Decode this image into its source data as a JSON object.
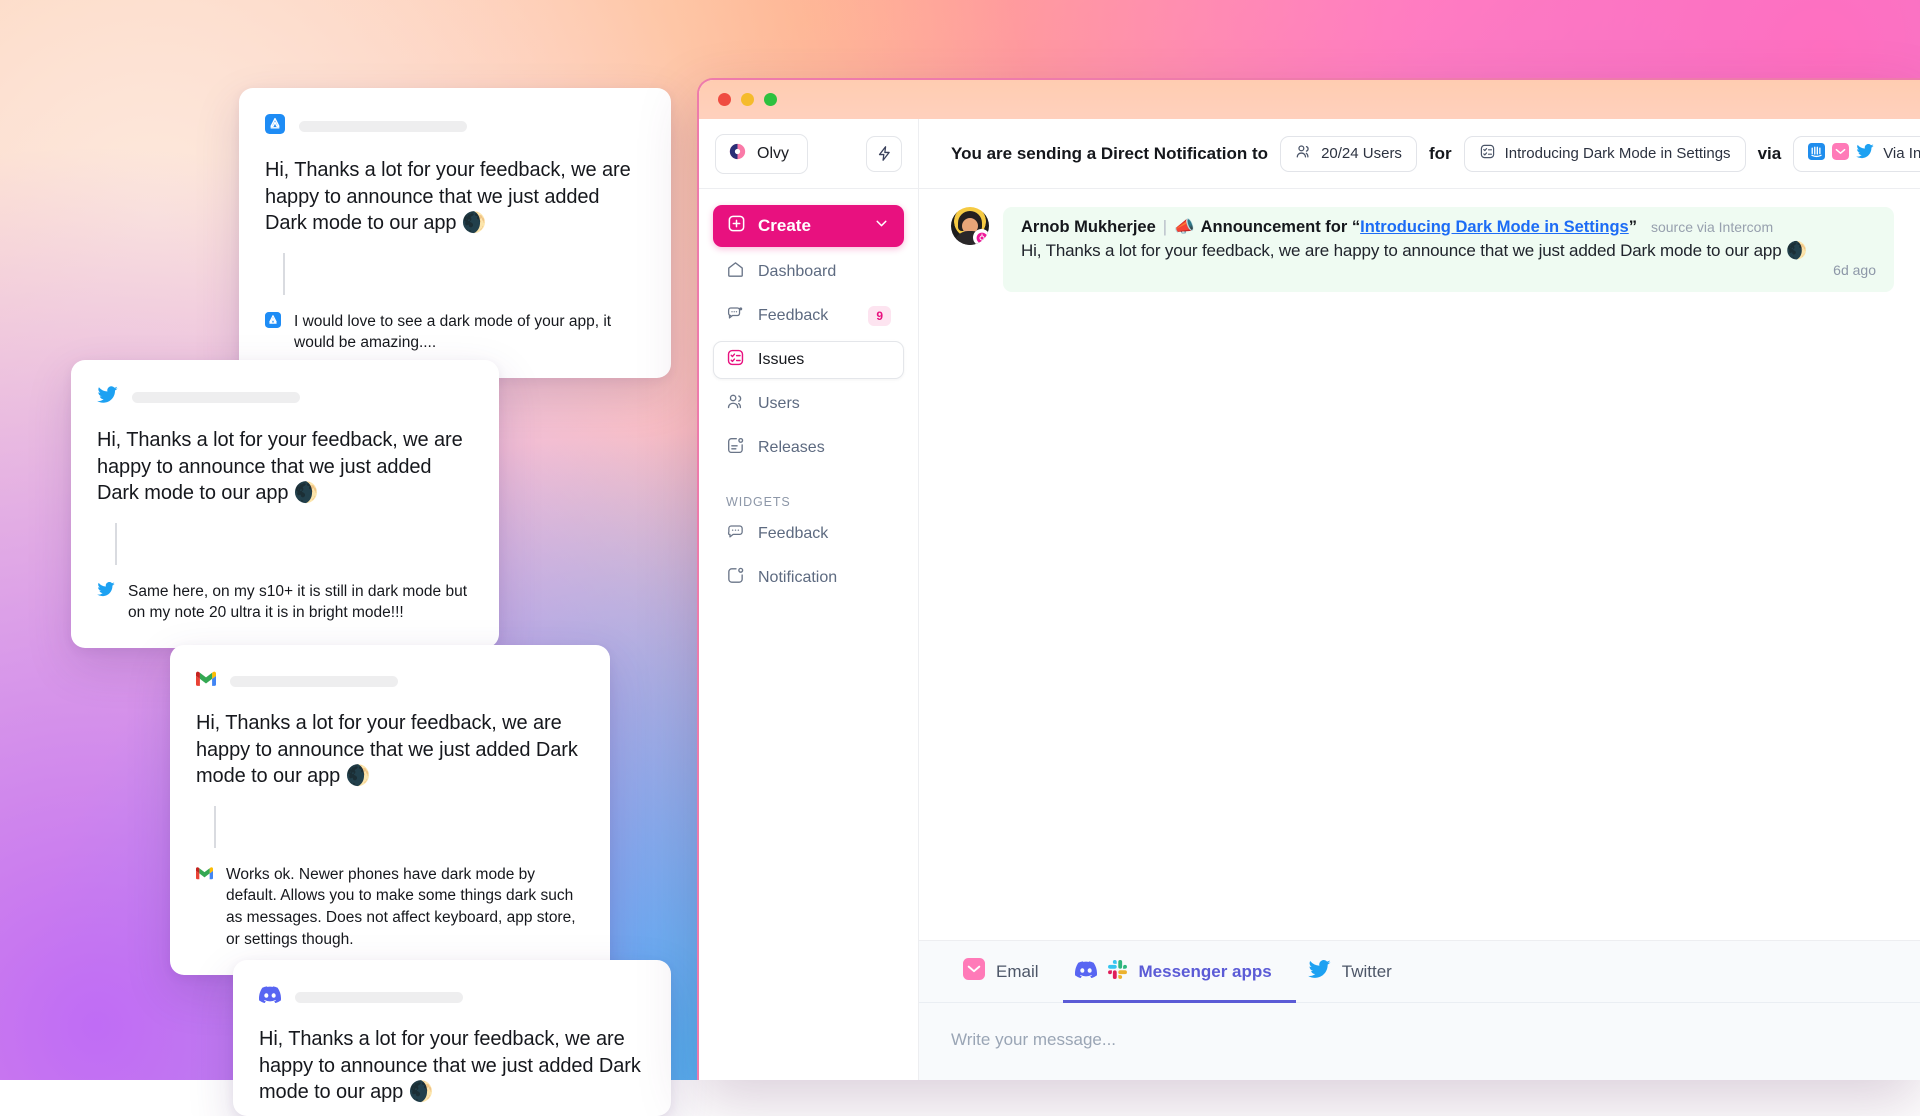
{
  "window": {
    "traffic_lights": [
      "close",
      "minimize",
      "zoom"
    ]
  },
  "sidebar": {
    "brand": "Olvy",
    "bolt_icon": "bolt-icon",
    "create_label": "Create",
    "nav": [
      {
        "label": "Dashboard",
        "icon": "home-icon",
        "badge": "",
        "active": false
      },
      {
        "label": "Feedback",
        "icon": "chat-icon",
        "badge": "9",
        "active": false
      },
      {
        "label": "Issues",
        "icon": "checklist-icon",
        "badge": "",
        "active": true
      },
      {
        "label": "Users",
        "icon": "users-icon",
        "badge": "",
        "active": false
      },
      {
        "label": "Releases",
        "icon": "release-icon",
        "badge": "",
        "active": false
      }
    ],
    "widgets_label": "WIDGETS",
    "widgets": [
      {
        "label": "Feedback",
        "icon": "chat-bubble-icon"
      },
      {
        "label": "Notification",
        "icon": "notification-icon"
      }
    ]
  },
  "topbar": {
    "prefix": "You are sending a Direct Notification to",
    "audience": "20/24 Users",
    "audience_icon": "users-icon",
    "for_label": "for",
    "release": "Introducing Dark Mode in Settings",
    "release_icon": "checklist-icon",
    "via_label": "via",
    "channels_text": "Via Intercom, Ema",
    "channel_icons": [
      "intercom-icon",
      "email-icon",
      "twitter-icon"
    ]
  },
  "message": {
    "author": "Arnob Mukherjee",
    "separator": "|",
    "megaphone": "📣",
    "announcement_prefix": "Announcement for “",
    "announcement_title": "Introducing Dark Mode in Settings",
    "announcement_suffix": "”",
    "source": "source via Intercom",
    "text": "Hi, Thanks a lot for your feedback, we are happy to announce that we just added Dark mode to our app 🌒",
    "time": "6d ago"
  },
  "composer": {
    "tabs": [
      {
        "label": "Email",
        "icons": [
          "email-icon"
        ],
        "active": false
      },
      {
        "label": "Messenger apps",
        "icons": [
          "discord-icon",
          "slack-icon"
        ],
        "active": true
      },
      {
        "label": "Twitter",
        "icons": [
          "twitter-icon"
        ],
        "active": false
      }
    ],
    "placeholder": "Write your message..."
  },
  "cards": [
    {
      "source": "appstore",
      "icon": "appstore-icon",
      "body": "Hi, Thanks a lot for your feedback, we are happy to announce that we just added Dark mode to our app 🌒",
      "reply": "I would love to see a dark mode of your app, it would be amazing...."
    },
    {
      "source": "twitter",
      "icon": "twitter-icon",
      "body": "Hi, Thanks a lot for your feedback, we are happy to announce that we just added Dark mode to our app 🌒",
      "reply": "Same here, on my s10+ it is still in dark mode but on my note 20 ultra it is in bright mode!!!"
    },
    {
      "source": "gmail",
      "icon": "gmail-icon",
      "body": "Hi, Thanks a lot for your feedback, we are happy to announce that we just added Dark mode to our app 🌒",
      "reply": "Works ok. Newer phones have dark mode by default. Allows you to make some things dark such as messages. Does not affect keyboard, app store, or settings though."
    },
    {
      "source": "discord",
      "icon": "discord-icon",
      "body": "Hi, Thanks a lot for your feedback, we are happy to announce that we just added Dark mode to our app 🌒",
      "reply": ""
    }
  ],
  "colors": {
    "accent_pink": "#e8117f",
    "tab_active": "#5b5bd6",
    "link_blue": "#1d6cf5",
    "bubble_green": "#effbf2"
  }
}
